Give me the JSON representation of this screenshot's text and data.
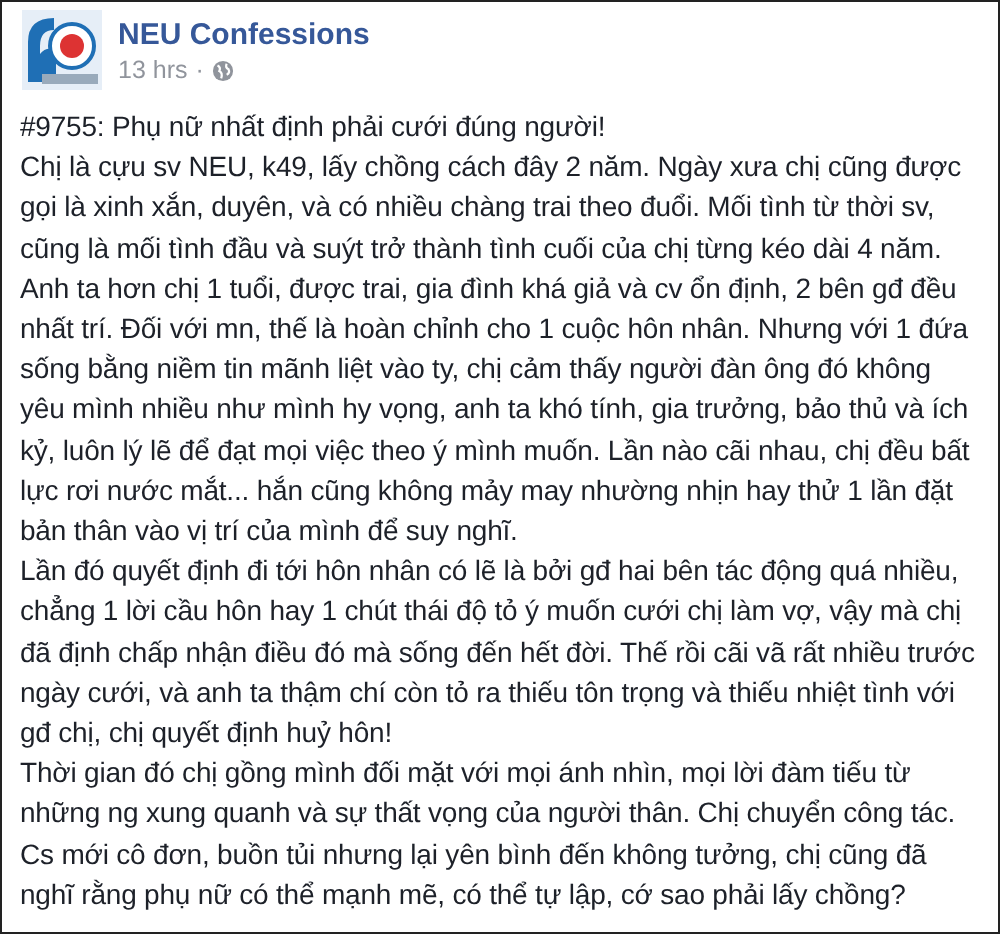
{
  "post": {
    "author": "NEU Confessions",
    "time": "13 hrs",
    "separator": "·",
    "paragraphs": [
      "#9755: Phụ nữ nhất định phải cưới đúng người!",
      "Chị là cựu sv NEU, k49, lấy chồng cách đây 2 năm. Ngày xưa chị cũng được gọi là xinh xắn, duyên, và có nhiều chàng trai theo đuổi. Mối tình từ thời sv, cũng là mối tình đầu và suýt trở thành tình cuối của chị từng kéo dài 4 năm. Anh ta hơn chị 1 tuổi, được trai, gia đình khá giả và cv ổn định, 2 bên gđ đều nhất trí. Đối với mn, thế là hoàn chỉnh cho 1 cuộc hôn nhân. Nhưng với 1 đứa sống bằng niềm tin mãnh liệt vào ty, chị cảm thấy người đàn ông đó không yêu mình nhiều như mình hy vọng, anh ta khó tính, gia trưởng, bảo thủ và ích kỷ, luôn lý lẽ để đạt mọi việc theo ý mình muốn. Lần nào cãi nhau, chị đều bất lực rơi nước mắt... hắn cũng không mảy may nhường nhịn hay thử 1 lần đặt bản thân vào vị trí của mình để suy nghĩ.",
      "Lần đó quyết định đi tới hôn nhân có lẽ là bởi gđ hai bên tác động quá nhiều, chẳng 1 lời cầu hôn hay 1 chút thái độ tỏ ý muốn cưới chị làm vợ, vậy mà chị đã định chấp nhận điều đó mà sống đến hết đời. Thế rồi cãi vã rất nhiều trước ngày cưới, và anh ta thậm chí còn tỏ ra thiếu tôn trọng và thiếu nhiệt tình với gđ chị, chị quyết định huỷ hôn!",
      "Thời gian đó chị gồng mình đối mặt với mọi ánh nhìn, mọi lời đàm tiếu từ những ng xung quanh và sự thất vọng của người thân. Chị chuyển công tác. Cs mới cô đơn, buồn tủi nhưng lại yên bình đến không tưởng, chị cũng đã nghĩ rằng phụ nữ có thể mạnh mẽ, có thể tự lập, cớ sao phải lấy chồng?"
    ]
  }
}
